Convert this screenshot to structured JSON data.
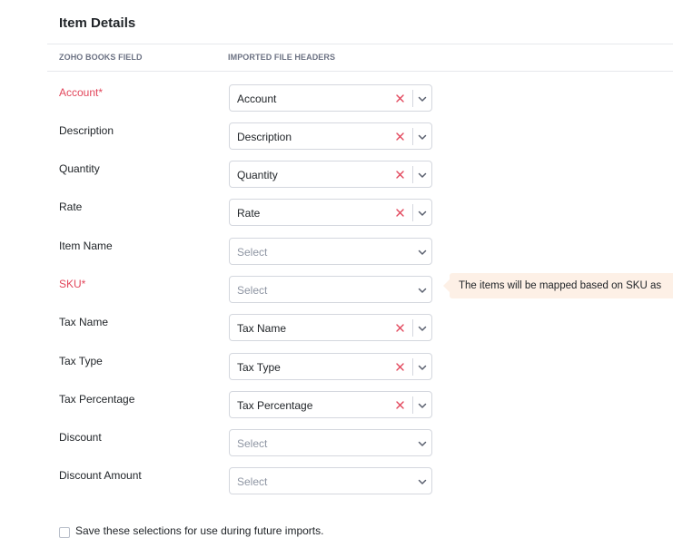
{
  "section": {
    "title": "Item Details"
  },
  "columns": {
    "field": "ZOHO BOOKS FIELD",
    "file": "IMPORTED FILE HEADERS"
  },
  "placeholder": "Select",
  "rows": [
    {
      "label": "Account*",
      "required": true,
      "value": "Account"
    },
    {
      "label": "Description",
      "required": false,
      "value": "Description"
    },
    {
      "label": "Quantity",
      "required": false,
      "value": "Quantity"
    },
    {
      "label": "Rate",
      "required": false,
      "value": "Rate"
    },
    {
      "label": "Item Name",
      "required": false,
      "value": ""
    },
    {
      "label": "SKU*",
      "required": true,
      "value": ""
    },
    {
      "label": "Tax Name",
      "required": false,
      "value": "Tax Name"
    },
    {
      "label": "Tax Type",
      "required": false,
      "value": "Tax Type"
    },
    {
      "label": "Tax Percentage",
      "required": false,
      "value": "Tax Percentage"
    },
    {
      "label": "Discount",
      "required": false,
      "value": ""
    },
    {
      "label": "Discount Amount",
      "required": false,
      "value": ""
    }
  ],
  "tooltip": {
    "text": "The items will be mapped based on SKU as"
  },
  "save": {
    "label": "Save these selections for use during future imports."
  },
  "colors": {
    "required": "#e2465b",
    "tooltip_bg": "#fdf0e6",
    "border": "#d4d7de"
  },
  "icons": {
    "clear": "close-icon",
    "dropdown": "chevron-down-icon"
  }
}
